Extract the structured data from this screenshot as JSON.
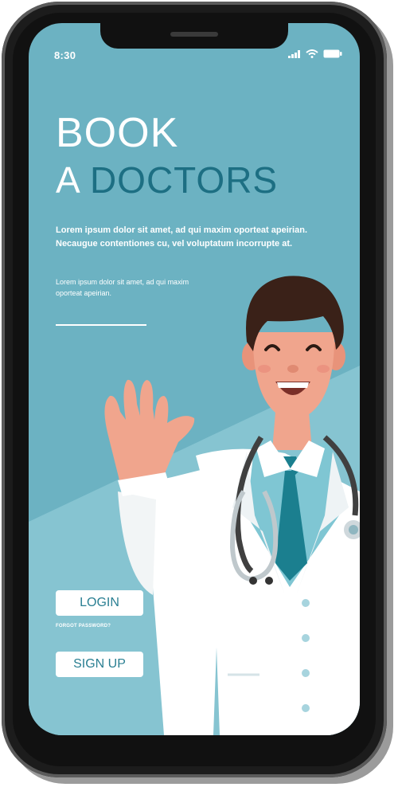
{
  "status_bar": {
    "time": "8:30"
  },
  "headline": {
    "line1": "BOOK",
    "line2_prefix": "A",
    "line2_highlight": "DOCTORS"
  },
  "lead_text": "Lorem ipsum dolor sit amet, ad qui maxim oporteat apeirian. Necaugue contentiones cu, vel voluptatum incorrupte at.",
  "sub_text": "Lorem ipsum dolor sit amet, ad qui maxim oporteat apeirian.",
  "actions": {
    "login_label": "LOGIN",
    "forgot_label": "FORGOT PASSWORD?",
    "signup_label": "SIGN UP"
  },
  "colors": {
    "screen_bg": "#6cb2c2",
    "accent": "#1d6f83",
    "tie": "#1b7f8f",
    "coat": "#ffffff"
  },
  "icons": [
    "signal-icon",
    "wifi-icon",
    "battery-icon",
    "doctor-illustration"
  ]
}
